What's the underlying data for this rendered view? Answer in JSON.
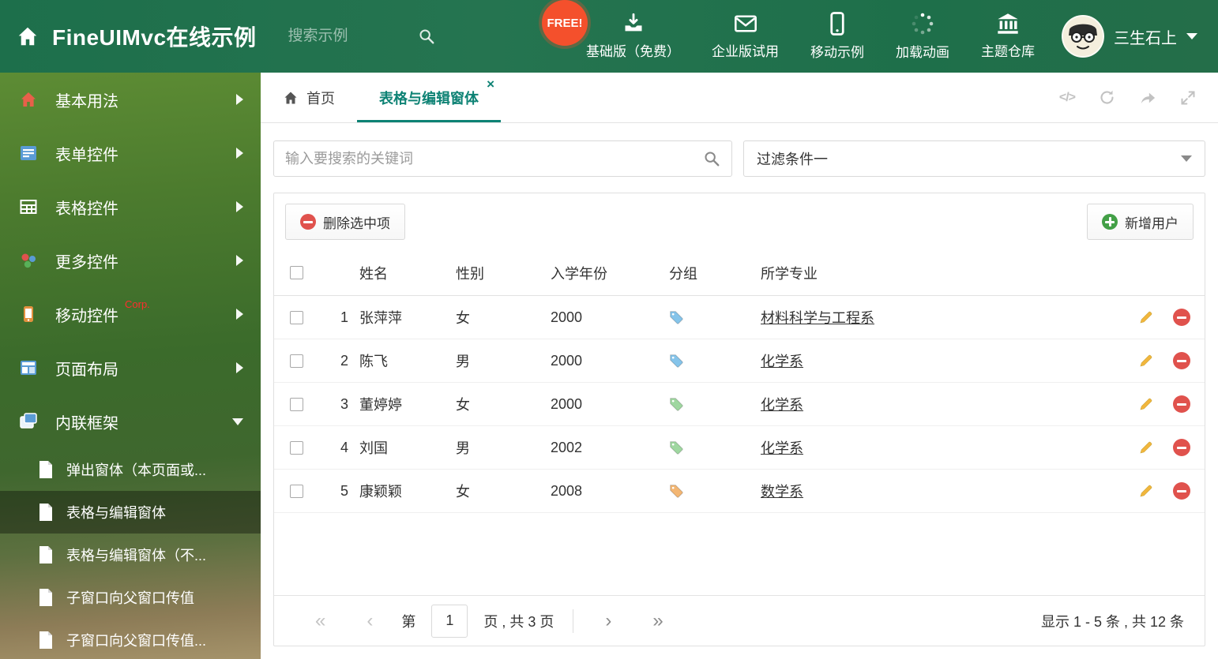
{
  "colors": {
    "header_green": "#1f7450",
    "tab_active_teal": "#0d8274",
    "delete_red": "#e0524d",
    "add_green": "#43a047",
    "free_badge_orange": "#f4502c"
  },
  "header": {
    "title": "FineUIMvc在线示例",
    "search_placeholder": "搜索示例",
    "free_badge": "FREE!",
    "nav": [
      {
        "label": "基础版（免费）",
        "icon": "download-icon"
      },
      {
        "label": "企业版试用",
        "icon": "envelope-icon"
      },
      {
        "label": "移动示例",
        "icon": "mobile-icon"
      },
      {
        "label": "加载动画",
        "icon": "spinner-icon"
      },
      {
        "label": "主题仓库",
        "icon": "bank-icon"
      }
    ],
    "user": {
      "name": "三生石上"
    }
  },
  "sidebar": {
    "items": [
      {
        "label": "基本用法"
      },
      {
        "label": "表单控件"
      },
      {
        "label": "表格控件"
      },
      {
        "label": "更多控件"
      },
      {
        "label": "移动控件",
        "badge": "Corp."
      },
      {
        "label": "页面布局"
      },
      {
        "label": "内联框架"
      }
    ],
    "subitems": [
      {
        "label": "弹出窗体（本页面或..."
      },
      {
        "label": "表格与编辑窗体"
      },
      {
        "label": "表格与编辑窗体（不..."
      },
      {
        "label": "子窗口向父窗口传值"
      },
      {
        "label": "子窗口向父窗口传值..."
      }
    ]
  },
  "tabs": {
    "home": "首页",
    "active": "表格与编辑窗体"
  },
  "content": {
    "search_placeholder": "输入要搜索的关键词",
    "filter_selected": "过滤条件一",
    "delete_button": "删除选中项",
    "add_button": "新增用户",
    "table": {
      "columns": {
        "name": "姓名",
        "gender": "性别",
        "year": "入学年份",
        "group": "分组",
        "major": "所学专业"
      },
      "rows": [
        {
          "num": "1",
          "name": "张萍萍",
          "gender": "女",
          "year": "2000",
          "tag_color": "#85c4ea",
          "major": "材料科学与工程系"
        },
        {
          "num": "2",
          "name": "陈飞",
          "gender": "男",
          "year": "2000",
          "tag_color": "#85c4ea",
          "major": "化学系"
        },
        {
          "num": "3",
          "name": "董婷婷",
          "gender": "女",
          "year": "2000",
          "tag_color": "#9fd7a0",
          "major": "化学系"
        },
        {
          "num": "4",
          "name": "刘国",
          "gender": "男",
          "year": "2002",
          "tag_color": "#9fd7a0",
          "major": "化学系"
        },
        {
          "num": "5",
          "name": "康颖颖",
          "gender": "女",
          "year": "2008",
          "tag_color": "#f3b673",
          "major": "数学系"
        }
      ]
    },
    "pagination": {
      "prefix": "第",
      "page": "1",
      "suffix": "页 , 共 3 页",
      "summary": "显示 1 - 5 条 , 共 12 条"
    }
  }
}
